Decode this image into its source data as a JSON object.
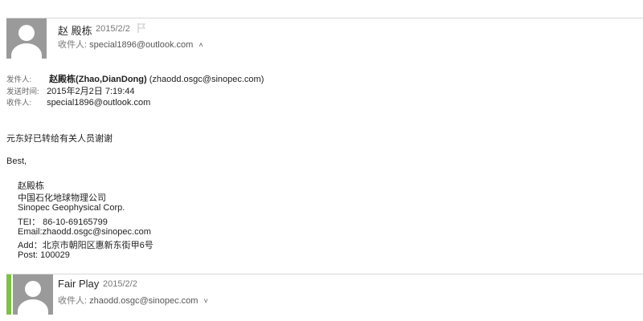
{
  "message1": {
    "sender_name": "赵 殿栋",
    "date": "2015/2/2",
    "recipient_label": "收件人:",
    "recipient": "special1896@outlook.com",
    "chevron_glyph": "˄"
  },
  "details": {
    "from_label": "发件人:",
    "from_name": "赵殿栋(Zhao,DianDong)",
    "from_email": "(zhaodd.osgc@sinopec.com)",
    "sent_label": "发送时间:",
    "sent_value": "2015年2月2日 7:19:44",
    "to_label": "收件人:",
    "to_value": "special1896@outlook.com"
  },
  "body": {
    "line1": "元东好已转给有关人员谢谢",
    "closing": "Best,"
  },
  "signature": {
    "lines": [
      "赵殿栋",
      "中国石化地球物理公司",
      "Sinopec Geophysical Corp.",
      "TEI：  86-10-69165799",
      "Email:zhaodd.osgc@sinopec.com",
      "Add：北京市朝阳区惠新东街甲6号",
      "Post:  100029"
    ]
  },
  "message2": {
    "sender_name": "Fair Play",
    "date": "2015/2/2",
    "recipient_label": "收件人:",
    "recipient": "zhaodd.osgc@sinopec.com",
    "chevron_glyph": "˅"
  },
  "colors": {
    "accent_green": "#7cc243",
    "avatar_gray": "#9a9a9a"
  }
}
